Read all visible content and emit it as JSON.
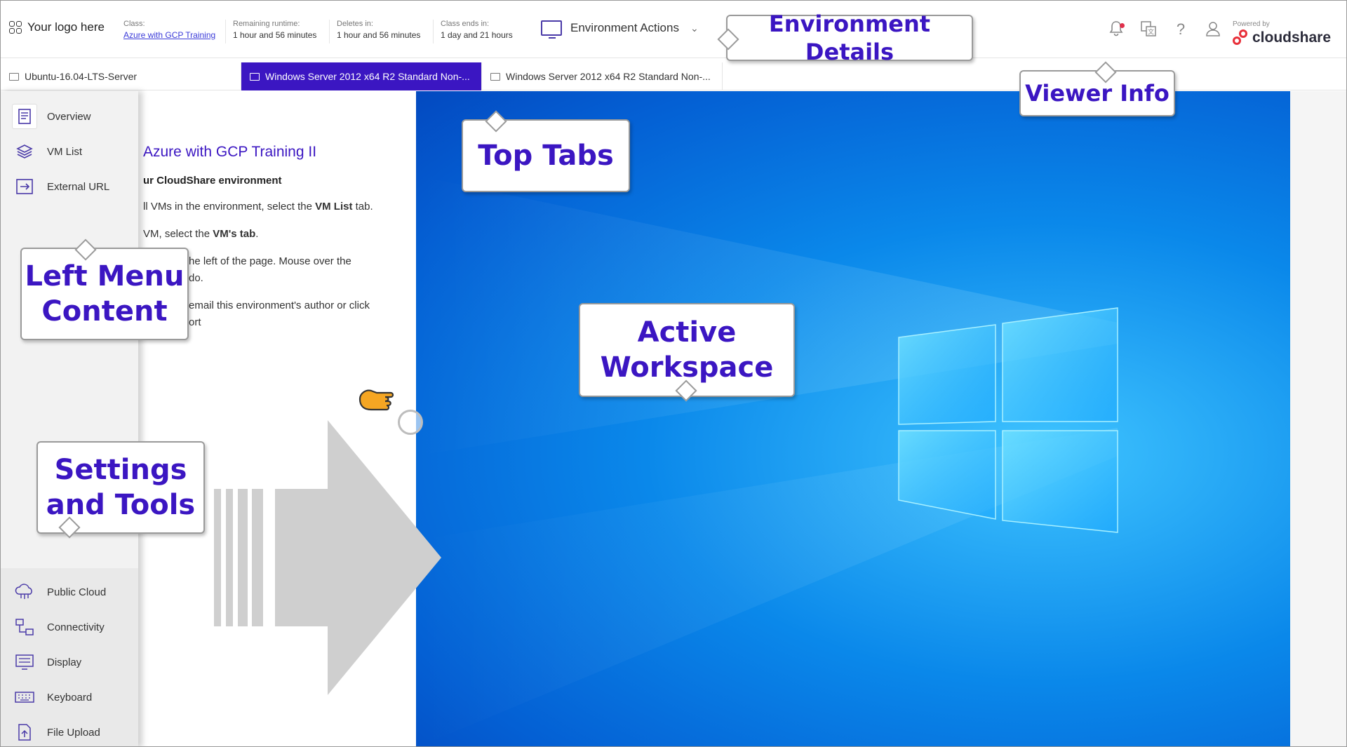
{
  "header": {
    "logo_text": "Your logo here",
    "class_label": "Class:",
    "class_value": "Azure with GCP Training",
    "runtime_label": "Remaining runtime:",
    "runtime_value": "1 hour and 56 minutes",
    "deletes_label": "Deletes in:",
    "deletes_value": "1 hour and 56 minutes",
    "class_ends_label": "Class ends in:",
    "class_ends_value": "1 day and 21 hours",
    "env_actions_label": "Environment Actions",
    "powered_by": "Powered by",
    "brand": "cloudshare",
    "icons": [
      "bell-icon",
      "translate-icon",
      "help-icon",
      "user-icon"
    ]
  },
  "tabs": [
    {
      "label": "Ubuntu-16.04-LTS-Server",
      "active": false
    },
    {
      "label": "Windows Server 2012 x64 R2 Standard Non-...",
      "active": true
    },
    {
      "label": "Windows Server 2012 x64 R2 Standard Non-...",
      "active": false
    }
  ],
  "sidebar": {
    "items": [
      {
        "label": "Overview",
        "icon": "overview-icon"
      },
      {
        "label": "VM List",
        "icon": "layers-icon"
      },
      {
        "label": "External URL",
        "icon": "external-url-icon"
      }
    ],
    "tools": [
      {
        "label": "Public Cloud",
        "icon": "cloud-icon"
      },
      {
        "label": "Connectivity",
        "icon": "connectivity-icon"
      },
      {
        "label": "Display",
        "icon": "display-icon"
      },
      {
        "label": "Keyboard",
        "icon": "keyboard-icon"
      },
      {
        "label": "File Upload",
        "icon": "file-upload-icon"
      }
    ]
  },
  "overview": {
    "title": "Azure with GCP Training II",
    "subtitle": "ur CloudShare environment",
    "line1_pre": "ll VMs in the environment, select the ",
    "line1_bold": "VM List",
    "line1_post": " tab.",
    "line2_pre": "VM, select the ",
    "line2_bold": "VM's tab",
    "line2_post": ".",
    "line3a": "he left of the page. Mouse over the",
    "line3b": "do.",
    "line4a": "email this environment's author or click",
    "line4b": "ort"
  },
  "callouts": {
    "environment_details": "Environment Details",
    "viewer_info": "Viewer Info",
    "top_tabs": "Top Tabs",
    "left_menu_line1": "Left Menu",
    "left_menu_line2": "Content",
    "active_workspace_line1": "Active",
    "active_workspace_line2": "Workspace",
    "settings_line1": "Settings",
    "settings_line2": "and Tools"
  },
  "colors": {
    "accent": "#3b16c2",
    "workspace_blue": "#0a88ea",
    "notification": "#e0304b",
    "brand_red": "#e8303a"
  }
}
